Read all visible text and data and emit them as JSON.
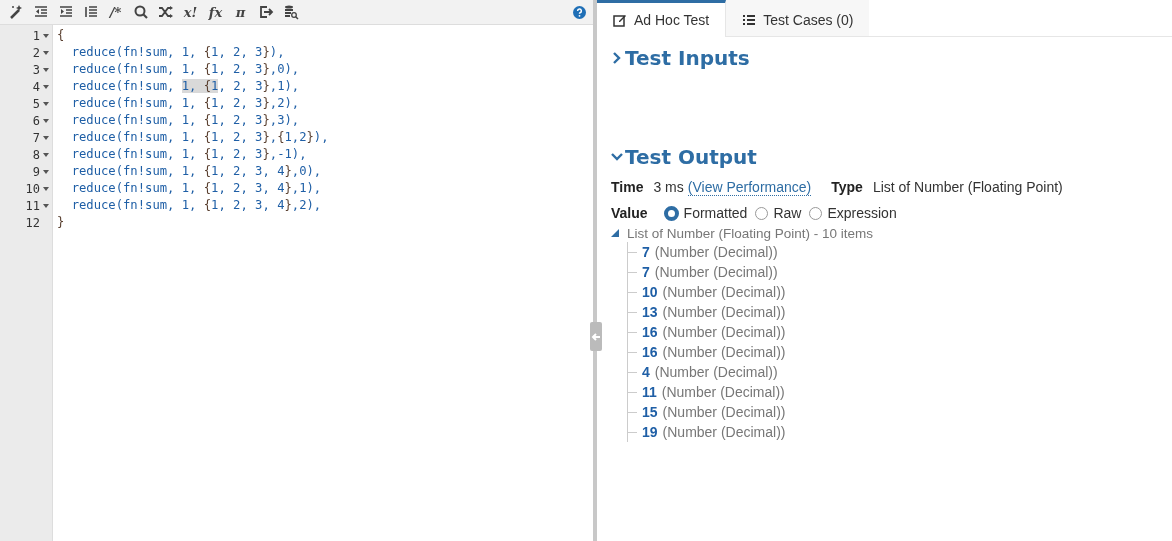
{
  "toolbar": [
    {
      "kind": "icon"
    },
    {
      "kind": "icon"
    },
    {
      "kind": "icon"
    },
    {
      "kind": "icon"
    },
    {
      "kind": "glyph",
      "text": "/*"
    },
    {
      "kind": "icon"
    },
    {
      "kind": "icon"
    },
    {
      "kind": "glyph",
      "text": "x!"
    },
    {
      "kind": "glyph",
      "text": "fx"
    },
    {
      "kind": "glyph",
      "text": "π"
    },
    {
      "kind": "icon"
    },
    {
      "kind": "icon"
    }
  ],
  "editor": {
    "lines": [
      {
        "number": "1",
        "foldable": true,
        "segments": [
          {
            "text": "{",
            "highlighted": false
          }
        ]
      },
      {
        "number": "2",
        "foldable": true,
        "segments": [
          {
            "text": "  reduce(fn!sum, 1, {1, 2, 3}),",
            "highlighted": false
          }
        ]
      },
      {
        "number": "3",
        "foldable": true,
        "segments": [
          {
            "text": "  reduce(fn!sum, 1, {1, 2, 3},0),",
            "highlighted": false
          }
        ]
      },
      {
        "number": "4",
        "foldable": true,
        "segments": [
          {
            "text": "  reduce(fn!sum, ",
            "highlighted": false
          },
          {
            "text": "1, {1",
            "highlighted": true
          },
          {
            "text": ", 2, 3},1),",
            "highlighted": false
          }
        ]
      },
      {
        "number": "5",
        "foldable": true,
        "segments": [
          {
            "text": "  reduce(fn!sum, 1, {1, 2, 3},2),",
            "highlighted": false
          }
        ]
      },
      {
        "number": "6",
        "foldable": true,
        "segments": [
          {
            "text": "  reduce(fn!sum, 1, {1, 2, 3},3),",
            "highlighted": false
          }
        ]
      },
      {
        "number": "7",
        "foldable": true,
        "segments": [
          {
            "text": "  reduce(fn!sum, 1, {1, 2, 3},{1,2}),",
            "highlighted": false
          }
        ]
      },
      {
        "number": "8",
        "foldable": true,
        "segments": [
          {
            "text": "  reduce(fn!sum, 1, {1, 2, 3},-1),",
            "highlighted": false
          }
        ]
      },
      {
        "number": "9",
        "foldable": true,
        "segments": [
          {
            "text": "  reduce(fn!sum, 1, {1, 2, 3, 4},0),",
            "highlighted": false
          }
        ]
      },
      {
        "number": "10",
        "foldable": true,
        "segments": [
          {
            "text": "  reduce(fn!sum, 1, {1, 2, 3, 4},1),",
            "highlighted": false
          }
        ]
      },
      {
        "number": "11",
        "foldable": true,
        "segments": [
          {
            "text": "  reduce(fn!sum, 1, {1, 2, 3, 4},2),",
            "highlighted": false
          }
        ]
      },
      {
        "number": "12",
        "foldable": false,
        "segments": [
          {
            "text": "}",
            "highlighted": false
          }
        ]
      }
    ]
  },
  "tabs": [
    {
      "label": "Ad Hoc Test",
      "selected": true
    },
    {
      "label": "Test Cases (0)",
      "selected": false
    }
  ],
  "test_inputs": {
    "title": "Test Inputs",
    "expanded": false
  },
  "test_output": {
    "title": "Test Output",
    "expanded": true,
    "time_label": "Time",
    "time": "3 ms",
    "performance_link": "(View Performance)",
    "type_label": "Type",
    "type": "List of Number (Floating Point)",
    "value_label": "Value",
    "value_modes": [
      {
        "label": "Formatted",
        "selected": true
      },
      {
        "label": "Raw",
        "selected": false
      },
      {
        "label": "Expression",
        "selected": false
      }
    ],
    "result": {
      "label": "List of Number (Floating Point) - 10 items",
      "expanded": true,
      "items": [
        {
          "value": "7",
          "type": "(Number (Decimal))"
        },
        {
          "value": "7",
          "type": "(Number (Decimal))"
        },
        {
          "value": "10",
          "type": "(Number (Decimal))"
        },
        {
          "value": "13",
          "type": "(Number (Decimal))"
        },
        {
          "value": "16",
          "type": "(Number (Decimal))"
        },
        {
          "value": "16",
          "type": "(Number (Decimal))"
        },
        {
          "value": "4",
          "type": "(Number (Decimal))"
        },
        {
          "value": "11",
          "type": "(Number (Decimal))"
        },
        {
          "value": "15",
          "type": "(Number (Decimal))"
        },
        {
          "value": "19",
          "type": "(Number (Decimal))"
        }
      ]
    }
  }
}
